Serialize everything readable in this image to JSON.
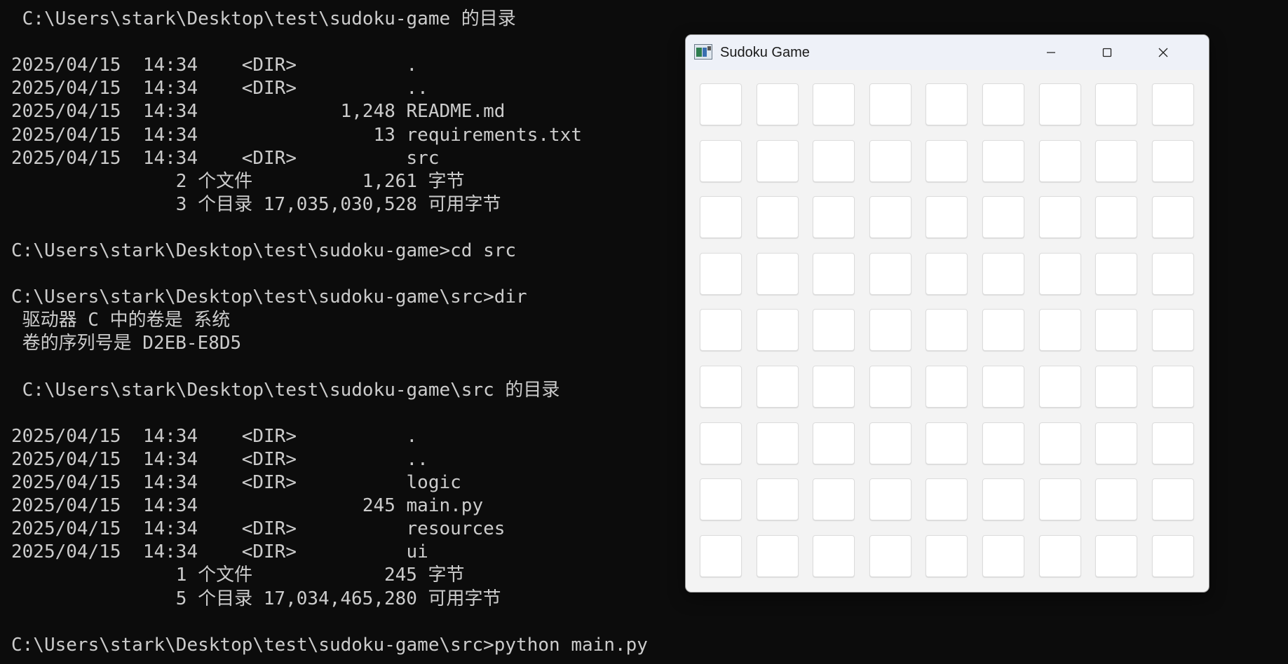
{
  "terminal": {
    "lines": [
      " C:\\Users\\stark\\Desktop\\test\\sudoku-game 的目录",
      "",
      "2025/04/15  14:34    <DIR>          .",
      "2025/04/15  14:34    <DIR>          ..",
      "2025/04/15  14:34             1,248 README.md",
      "2025/04/15  14:34                13 requirements.txt",
      "2025/04/15  14:34    <DIR>          src",
      "               2 个文件          1,261 字节",
      "               3 个目录 17,035,030,528 可用字节",
      "",
      "C:\\Users\\stark\\Desktop\\test\\sudoku-game>cd src",
      "",
      "C:\\Users\\stark\\Desktop\\test\\sudoku-game\\src>dir",
      " 驱动器 C 中的卷是 系统",
      " 卷的序列号是 D2EB-E8D5",
      "",
      " C:\\Users\\stark\\Desktop\\test\\sudoku-game\\src 的目录",
      "",
      "2025/04/15  14:34    <DIR>          .",
      "2025/04/15  14:34    <DIR>          ..",
      "2025/04/15  14:34    <DIR>          logic",
      "2025/04/15  14:34               245 main.py",
      "2025/04/15  14:34    <DIR>          resources",
      "2025/04/15  14:34    <DIR>          ui",
      "               1 个文件            245 字节",
      "               5 个目录 17,034,465,280 可用字节",
      "",
      "C:\\Users\\stark\\Desktop\\test\\sudoku-game\\src>python main.py"
    ]
  },
  "window": {
    "title": "Sudoku Game",
    "icon": "app-icon",
    "controls": [
      "minimize-icon",
      "maximize-icon",
      "close-icon"
    ]
  },
  "board": {
    "rows": 9,
    "cols": 9,
    "cells": [
      [
        "",
        "",
        "",
        "",
        "",
        "",
        "",
        "",
        ""
      ],
      [
        "",
        "",
        "",
        "",
        "",
        "",
        "",
        "",
        ""
      ],
      [
        "",
        "",
        "",
        "",
        "",
        "",
        "",
        "",
        ""
      ],
      [
        "",
        "",
        "",
        "",
        "",
        "",
        "",
        "",
        ""
      ],
      [
        "",
        "",
        "",
        "",
        "",
        "",
        "",
        "",
        ""
      ],
      [
        "",
        "",
        "",
        "",
        "",
        "",
        "",
        "",
        ""
      ],
      [
        "",
        "",
        "",
        "",
        "",
        "",
        "",
        "",
        ""
      ],
      [
        "",
        "",
        "",
        "",
        "",
        "",
        "",
        "",
        ""
      ],
      [
        "",
        "",
        "",
        "",
        "",
        "",
        "",
        "",
        ""
      ]
    ]
  },
  "colors": {
    "terminal_bg": "#0c0c0c",
    "terminal_fg": "#cccccc",
    "window_bg": "#f3f3f3",
    "titlebar_bg": "#eef1f8",
    "cell_bg": "#ffffff"
  }
}
